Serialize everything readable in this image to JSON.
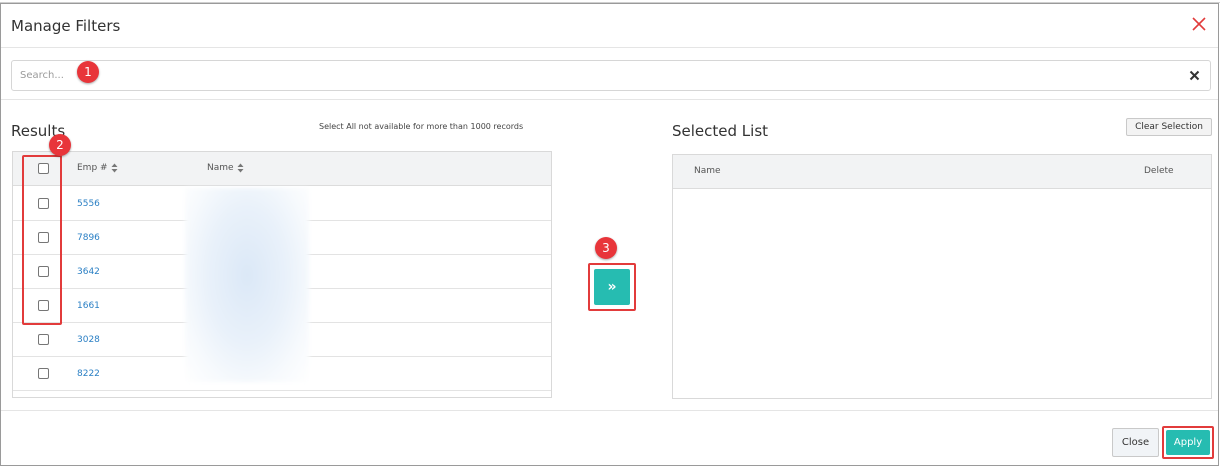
{
  "window": {
    "title": "Manage Filters"
  },
  "search": {
    "placeholder": "Search...",
    "value": ""
  },
  "results": {
    "label": "Results",
    "note": "Select All not available for more than 1000 records",
    "columns": {
      "emp": "Emp #",
      "name": "Name"
    },
    "rows": [
      {
        "emp": "5556"
      },
      {
        "emp": "7896"
      },
      {
        "emp": "3642"
      },
      {
        "emp": "1661"
      },
      {
        "emp": "3028"
      },
      {
        "emp": "8222"
      }
    ]
  },
  "selected": {
    "label": "Selected List",
    "clear_button": "Clear Selection",
    "columns": {
      "name": "Name",
      "delete": "Delete"
    }
  },
  "move_button": {
    "glyph": "»"
  },
  "footer": {
    "close_label": "Close",
    "apply_label": "Apply"
  },
  "markers": [
    "1",
    "2",
    "3"
  ],
  "colors": {
    "accent": "#26bcb1",
    "link": "#2a7fc4",
    "marker": "#e8353a",
    "close": "#e23b3b"
  }
}
